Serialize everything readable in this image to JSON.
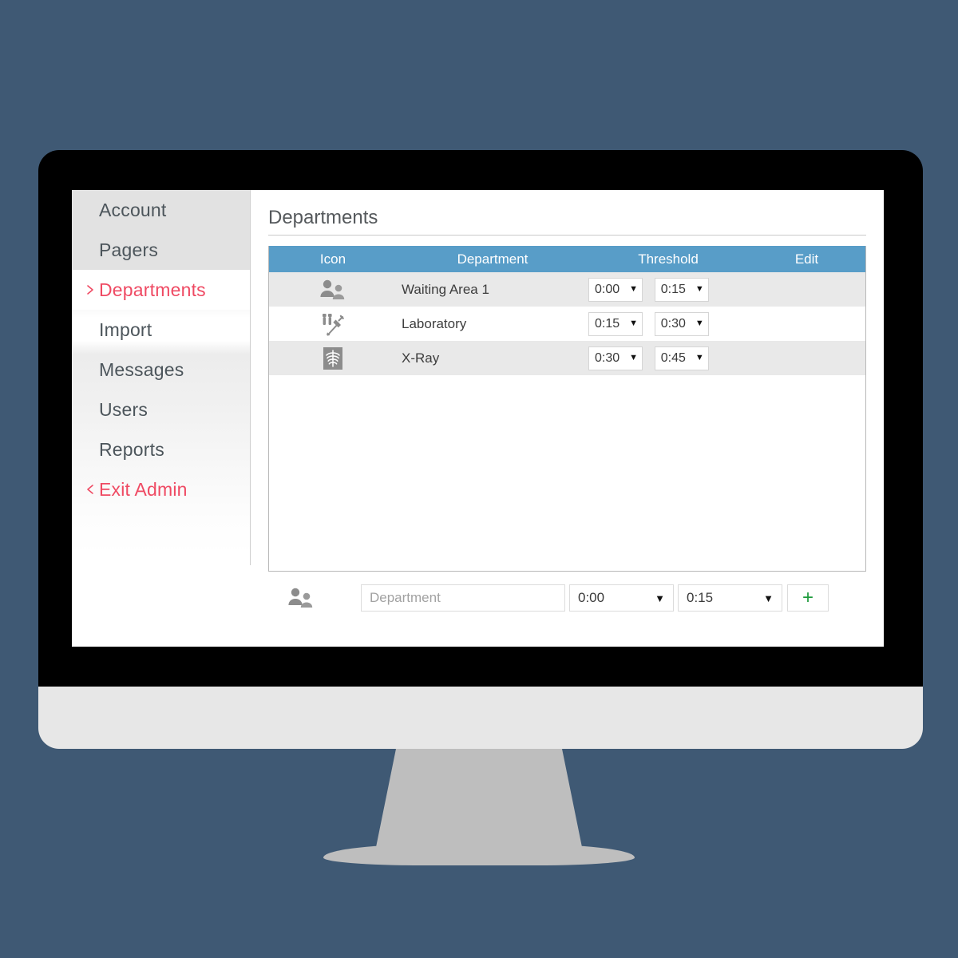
{
  "background_color": "#3f5974",
  "device": {
    "name": "desktop-monitor",
    "bezel_color": "#000000",
    "chin_color": "#e7e7e7",
    "stand_color": "#bebebe"
  },
  "sidebar": {
    "items": [
      {
        "label": "Account",
        "icon": "none",
        "active": false,
        "accent": false
      },
      {
        "label": "Pagers",
        "icon": "none",
        "active": false,
        "accent": false
      },
      {
        "label": "Departments",
        "icon": "chevron-right",
        "active": true,
        "accent": true
      },
      {
        "label": "Import",
        "icon": "none",
        "active": false,
        "accent": false
      },
      {
        "label": "Messages",
        "icon": "none",
        "active": false,
        "accent": false
      },
      {
        "label": "Users",
        "icon": "none",
        "active": false,
        "accent": false
      },
      {
        "label": "Reports",
        "icon": "none",
        "active": false,
        "accent": false
      },
      {
        "label": "Exit Admin",
        "icon": "chevron-left",
        "active": false,
        "accent": true
      }
    ],
    "accent_color": "#ef4a63",
    "text_color": "#4c555b"
  },
  "main": {
    "page_title": "Departments",
    "table": {
      "header_color": "#589dc8",
      "columns": [
        "Icon",
        "Department",
        "Threshold",
        "Edit"
      ],
      "rows": [
        {
          "icon": "two-people-icon",
          "department": "Waiting Area 1",
          "threshold_low": "0:00",
          "threshold_high": "0:15",
          "edit": ""
        },
        {
          "icon": "syringe-test-tubes-icon",
          "department": "Laboratory",
          "threshold_low": "0:15",
          "threshold_high": "0:30",
          "edit": ""
        },
        {
          "icon": "xray-ribcage-icon",
          "department": "X-Ray",
          "threshold_low": "0:30",
          "threshold_high": "0:45",
          "edit": ""
        }
      ]
    },
    "add_row": {
      "icon": "two-people-icon",
      "department_placeholder": "Department",
      "department_value": "",
      "threshold_low": "0:00",
      "threshold_high": "0:15",
      "add_label": "+",
      "add_color": "#1e9b3c"
    }
  }
}
